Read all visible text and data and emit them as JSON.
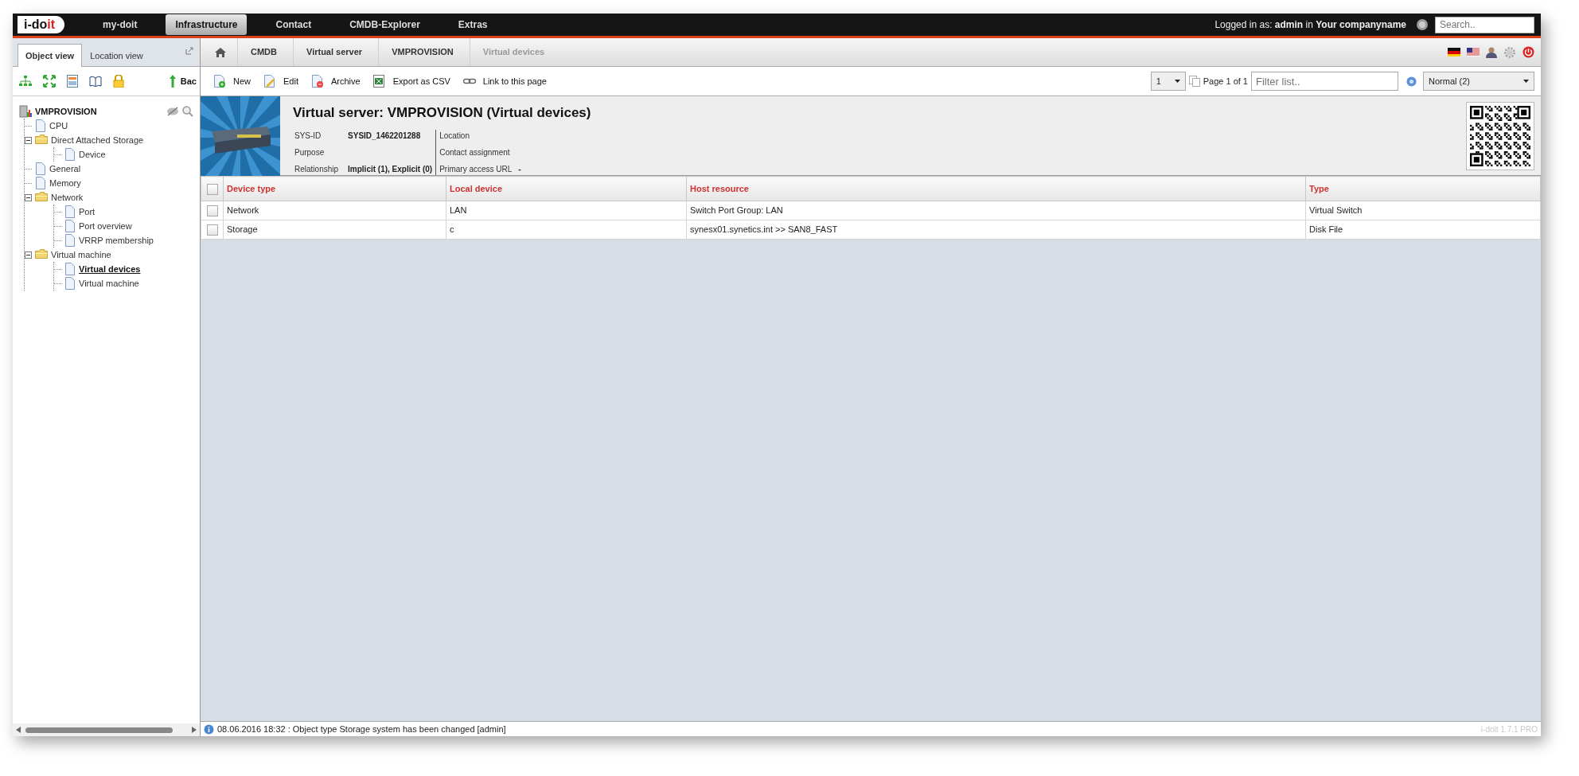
{
  "logo": {
    "main": "i-do",
    "accent": "it"
  },
  "nav": [
    {
      "label": "my-doit",
      "selected": false
    },
    {
      "label": "Infrastructure",
      "selected": true
    },
    {
      "label": "Contact",
      "selected": false
    },
    {
      "label": "CMDB-Explorer",
      "selected": false
    },
    {
      "label": "Extras",
      "selected": false
    }
  ],
  "login_text": "Logged in as: **admin** in **Your companyname**",
  "search": {
    "placeholder": "Search.."
  },
  "sidebar": {
    "tabs": [
      {
        "label": "Object view",
        "selected": true
      },
      {
        "label": "Location view",
        "selected": false
      }
    ],
    "back_label": "Bac",
    "tree": {
      "label": "VMPROVISION",
      "children": [
        {
          "label": "CPU",
          "kind": "page",
          "selected": false
        },
        {
          "label": "Direct Attached Storage",
          "kind": "folder",
          "expanded": true,
          "children": [
            {
              "label": "Device",
              "kind": "page",
              "selected": false
            }
          ]
        },
        {
          "label": "General",
          "kind": "page",
          "selected": false
        },
        {
          "label": "Memory",
          "kind": "page",
          "selected": false
        },
        {
          "label": "Network",
          "kind": "folder",
          "expanded": true,
          "children": [
            {
              "label": "Port",
              "kind": "page",
              "selected": false
            },
            {
              "label": "Port overview",
              "kind": "page",
              "selected": false
            },
            {
              "label": "VRRP membership",
              "kind": "page",
              "selected": false
            }
          ]
        },
        {
          "label": "Virtual machine",
          "kind": "folder",
          "expanded": true,
          "children": [
            {
              "label": "Virtual devices",
              "kind": "page",
              "selected": true
            },
            {
              "label": "Virtual machine",
              "kind": "page",
              "selected": false
            }
          ]
        }
      ]
    }
  },
  "breadcrumb": [
    {
      "label": "CMDB",
      "selected": false
    },
    {
      "label": "Virtual server",
      "selected": false
    },
    {
      "label": "VMPROVISION",
      "selected": false
    },
    {
      "label": "Virtual devices",
      "selected": true
    }
  ],
  "toolbar": [
    {
      "label": "New",
      "kind": "new"
    },
    {
      "label": "Edit",
      "kind": "edit"
    },
    {
      "label": "Archive",
      "kind": "archive"
    },
    {
      "label": "Export as CSV",
      "kind": "csv"
    },
    {
      "label": "Link to this page",
      "kind": "link"
    }
  ],
  "pager": {
    "page": "1",
    "page_info": "Page 1 of 1",
    "filter_placeholder": "Filter list..",
    "view": "Normal (2)"
  },
  "object": {
    "title": "Virtual server: VMPROVISION (Virtual devices)",
    "fields_left": [
      {
        "label": "SYS-ID",
        "value": "SYSID_1462201288"
      },
      {
        "label": "Purpose"
      },
      {
        "label": "Relationship",
        "value": "Implicit (1), Explicit (0)"
      }
    ],
    "fields_right": [
      {
        "label": "Location"
      },
      {
        "label": "Contact assignment"
      },
      {
        "label": "Primary access URL",
        "value": "-"
      }
    ]
  },
  "table": {
    "select_all_checked": false,
    "columns": [
      "Device type",
      "Local device",
      "Host resource",
      "Type"
    ],
    "rows": [
      {
        "checked": false,
        "cells": [
          "Network",
          "LAN",
          "Switch Port Group: LAN",
          "Virtual Switch"
        ]
      },
      {
        "checked": false,
        "cells": [
          "Storage",
          "c",
          "synesx01.synetics.int >> SAN8_FAST",
          "Disk File"
        ]
      }
    ]
  },
  "status": {
    "message": "08.06.2016 18:32 : Object type Storage system has been changed [admin]",
    "version": "i-doit 1.7.1 PRO"
  }
}
